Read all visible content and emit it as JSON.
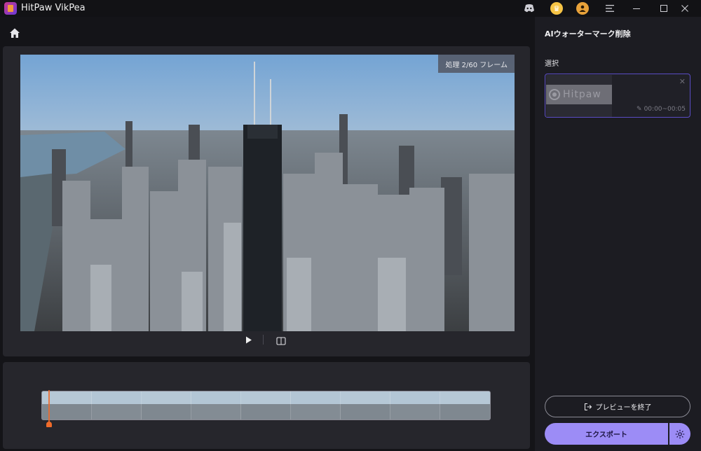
{
  "app": {
    "title": "HitPaw VikPea"
  },
  "titlebar": {
    "icons": [
      "discord-icon",
      "coin-icon",
      "user-icon",
      "menu-icon"
    ],
    "window_buttons": [
      "minimize-icon",
      "maximize-icon",
      "close-icon"
    ]
  },
  "preview": {
    "frame_badge": "処理 2/60 フレーム"
  },
  "sidebar": {
    "title": "AIウォーターマーク削除",
    "select_label": "選択",
    "selection_card": {
      "watermark_text": "Hitpaw",
      "time_range": "00:00~00:05"
    },
    "preview_exit_label": "プレビューを終了",
    "export_label": "エクスポート"
  },
  "colors": {
    "accent": "#9c8cf6",
    "playhead": "#f06b2a",
    "selection_border": "#5a4cc4"
  }
}
